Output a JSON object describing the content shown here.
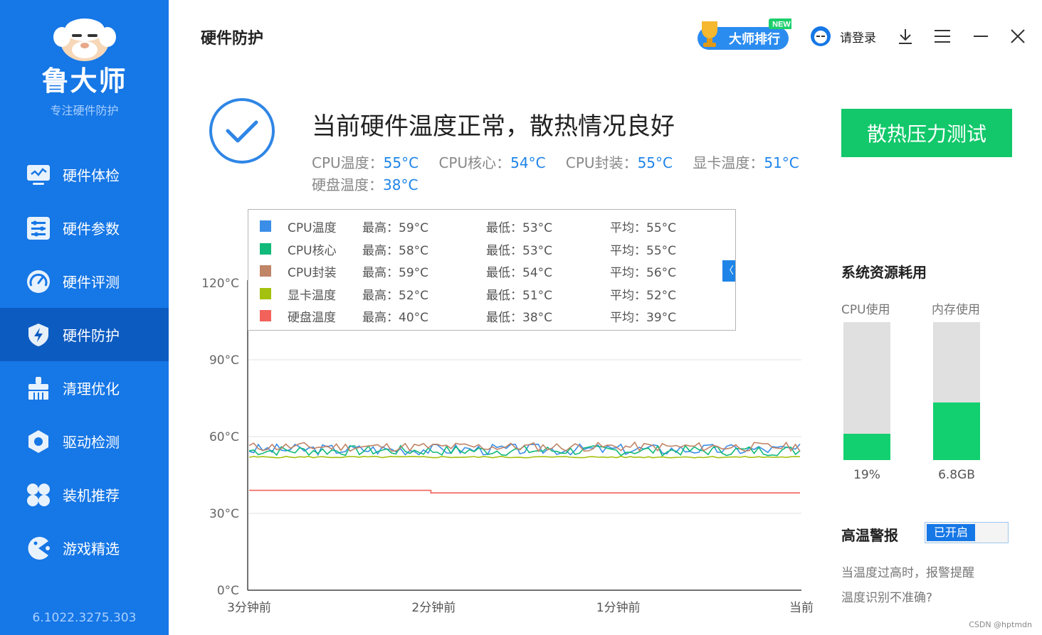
{
  "sidebar": {
    "brand": "鲁大师",
    "tagline": "专注硬件防护",
    "version": "6.1022.3275.303",
    "items": [
      {
        "label": "硬件体检",
        "icon": "monitor-check-icon"
      },
      {
        "label": "硬件参数",
        "icon": "list-sliders-icon"
      },
      {
        "label": "硬件评测",
        "icon": "speedometer-icon"
      },
      {
        "label": "硬件防护",
        "icon": "shield-bolt-icon",
        "active": true
      },
      {
        "label": "清理优化",
        "icon": "broom-icon"
      },
      {
        "label": "驱动检测",
        "icon": "gear-hex-icon"
      },
      {
        "label": "装机推荐",
        "icon": "petal-grid-icon"
      },
      {
        "label": "游戏精选",
        "icon": "game-pacman-icon"
      }
    ]
  },
  "header": {
    "title": "硬件防护",
    "rank_label": "大师排行",
    "rank_badge": "NEW",
    "login": "请登录"
  },
  "status": {
    "headline": "当前硬件温度正常，散热情况良好",
    "temps": [
      {
        "label": "CPU温度：",
        "value": "55°C"
      },
      {
        "label": "CPU核心：",
        "value": "54°C"
      },
      {
        "label": "CPU封装：",
        "value": "55°C"
      },
      {
        "label": "显卡温度：",
        "value": "51°C"
      },
      {
        "label": "硬盘温度：",
        "value": "38°C"
      }
    ]
  },
  "stress_test_label": "散热压力测试",
  "legend": [
    {
      "name": "CPU温度",
      "max": "最高：59°C",
      "min": "最低：53°C",
      "avg": "平均：55°C",
      "color": "#3a8ee8"
    },
    {
      "name": "CPU核心",
      "max": "最高：58°C",
      "min": "最低：53°C",
      "avg": "平均：55°C",
      "color": "#11b97a"
    },
    {
      "name": "CPU封装",
      "max": "最高：59°C",
      "min": "最低：54°C",
      "avg": "平均：56°C",
      "color": "#c08466"
    },
    {
      "name": "显卡温度",
      "max": "最高：52°C",
      "min": "最低：51°C",
      "avg": "平均：52°C",
      "color": "#a5c10f"
    },
    {
      "name": "硬盘温度",
      "max": "最高：40°C",
      "min": "最低：38°C",
      "avg": "平均：39°C",
      "color": "#f2625a"
    }
  ],
  "collapse_glyph": "〈",
  "chart_data": {
    "type": "line",
    "y_ticks": [
      "120°C",
      "90°C",
      "60°C",
      "30°C",
      "0°C"
    ],
    "x_ticks": [
      "3分钟前",
      "2分钟前",
      "1分钟前",
      "当前"
    ],
    "ylim": [
      0,
      120
    ],
    "grid": true,
    "series": [
      {
        "name": "CPU温度",
        "color": "#3a8ee8",
        "base": 55,
        "amp": 2.2,
        "seed": 3
      },
      {
        "name": "CPU核心",
        "color": "#11b97a",
        "base": 54.5,
        "amp": 2.0,
        "seed": 7
      },
      {
        "name": "CPU封装",
        "color": "#c08466",
        "base": 56,
        "amp": 1.8,
        "seed": 11
      },
      {
        "name": "显卡温度",
        "color": "#a5c10f",
        "base": 52,
        "amp": 0.3,
        "seed": 5
      },
      {
        "name": "硬盘温度",
        "color": "#f2625a",
        "steps": [
          [
            0,
            39
          ],
          [
            0.33,
            38
          ],
          [
            1,
            38
          ]
        ]
      }
    ]
  },
  "resources": {
    "title": "系统资源耗用",
    "cpu": {
      "label": "CPU使用",
      "value": "19%",
      "fraction": 0.19
    },
    "mem": {
      "label": "内存使用",
      "value": "6.8GB",
      "fraction": 0.42
    }
  },
  "alarm": {
    "title": "高温警报",
    "toggle_label": "已开启",
    "desc": "当温度过高时，报警提醒",
    "link": "温度识别不准确?"
  },
  "credit": "CSDN @hptmdn"
}
